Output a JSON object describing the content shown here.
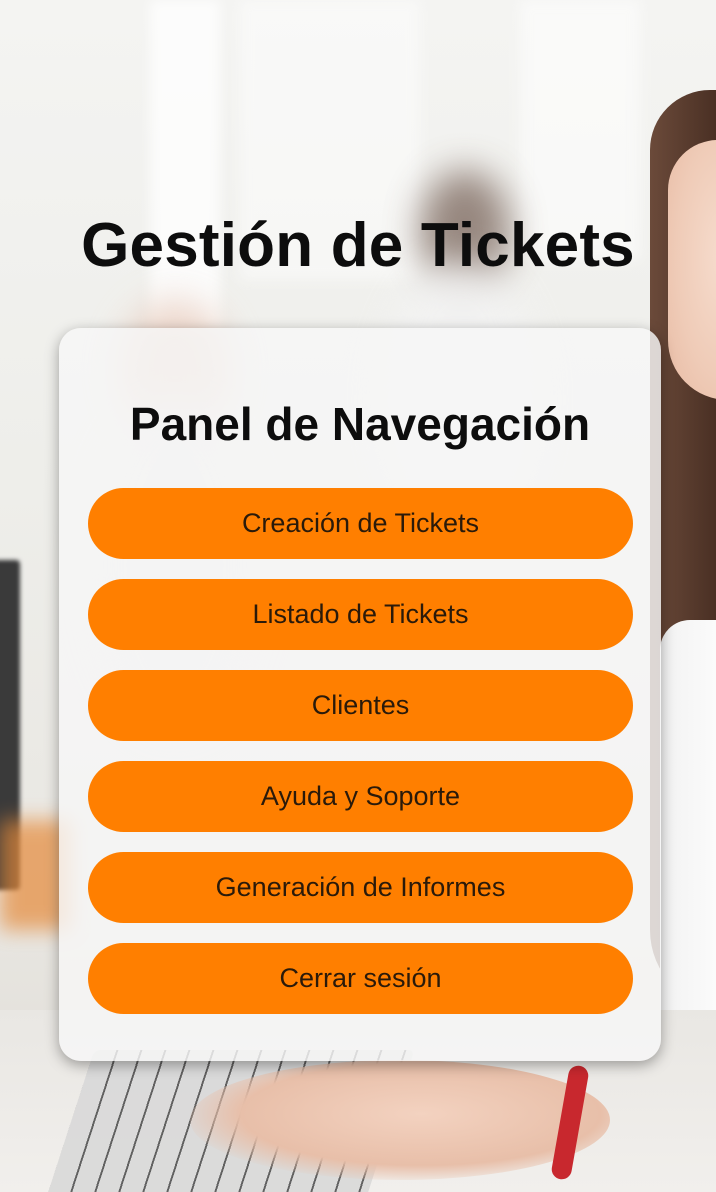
{
  "header": {
    "title": "Gestión de Tickets"
  },
  "panel": {
    "title": "Panel de Navegación",
    "buttons": [
      {
        "label": "Creación de Tickets"
      },
      {
        "label": "Listado de Tickets"
      },
      {
        "label": "Clientes"
      },
      {
        "label": "Ayuda y Soporte"
      },
      {
        "label": "Generación de Informes"
      },
      {
        "label": "Cerrar sesión"
      }
    ]
  },
  "colors": {
    "button": "#ff7f00",
    "panel": "#f6f6f6",
    "title": "#0d0d0d"
  }
}
